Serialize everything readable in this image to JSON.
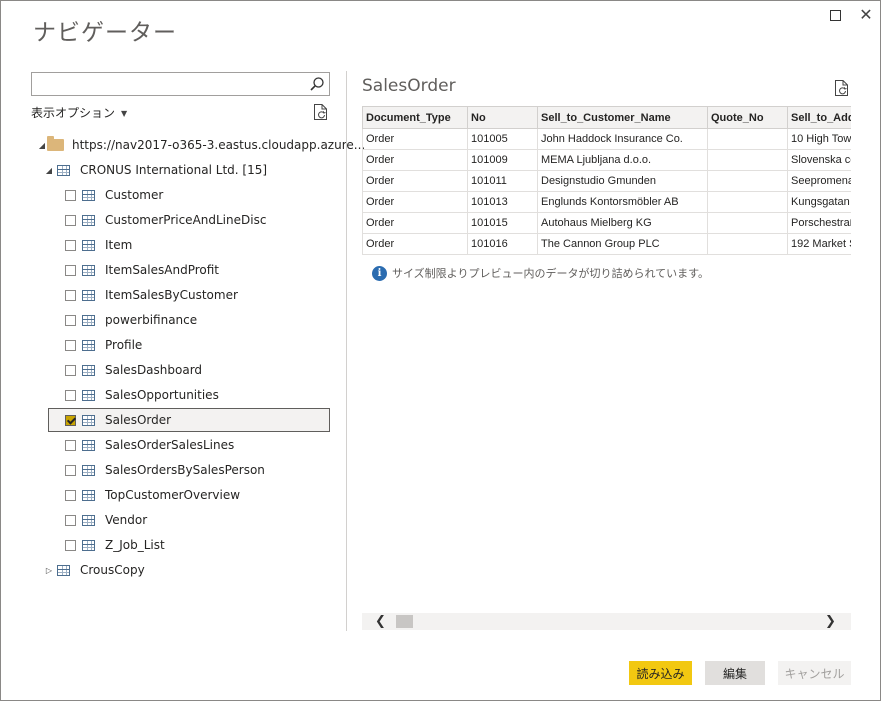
{
  "window": {
    "title": "ナビゲーター"
  },
  "search": {
    "placeholder": ""
  },
  "display_options": {
    "label": "表示オプション"
  },
  "tree": {
    "root": {
      "label": "https://nav2017-o365-3.eastus.cloudapp.azure..."
    },
    "company": {
      "label": "CRONUS International Ltd. [15]"
    },
    "items": [
      {
        "label": "Customer",
        "checked": false
      },
      {
        "label": "CustomerPriceAndLineDisc",
        "checked": false
      },
      {
        "label": "Item",
        "checked": false
      },
      {
        "label": "ItemSalesAndProfit",
        "checked": false
      },
      {
        "label": "ItemSalesByCustomer",
        "checked": false
      },
      {
        "label": "powerbifinance",
        "checked": false
      },
      {
        "label": "Profile",
        "checked": false
      },
      {
        "label": "SalesDashboard",
        "checked": false
      },
      {
        "label": "SalesOpportunities",
        "checked": false
      },
      {
        "label": "SalesOrder",
        "checked": true
      },
      {
        "label": "SalesOrderSalesLines",
        "checked": false
      },
      {
        "label": "SalesOrdersBySalesPerson",
        "checked": false
      },
      {
        "label": "TopCustomerOverview",
        "checked": false
      },
      {
        "label": "Vendor",
        "checked": false
      },
      {
        "label": "Z_Job_List",
        "checked": false
      }
    ],
    "other": {
      "label": "CrousCopy"
    }
  },
  "preview": {
    "title": "SalesOrder",
    "columns": [
      "Document_Type",
      "No",
      "Sell_to_Customer_Name",
      "Quote_No",
      "Sell_to_Add"
    ],
    "rows": [
      [
        "Order",
        "101005",
        "John Haddock Insurance Co.",
        "",
        "10 High Tow"
      ],
      [
        "Order",
        "101009",
        "MEMA Ljubljana d.o.o.",
        "",
        "Slovenska cc"
      ],
      [
        "Order",
        "101011",
        "Designstudio Gmunden",
        "",
        "Seepromena"
      ],
      [
        "Order",
        "101013",
        "Englunds Kontorsmöbler AB",
        "",
        "Kungsgatan"
      ],
      [
        "Order",
        "101015",
        "Autohaus Mielberg KG",
        "",
        "Porschestraß"
      ],
      [
        "Order",
        "101016",
        "The Cannon Group PLC",
        "",
        "192 Market S"
      ]
    ],
    "info_text": "サイズ制限よりプレビュー内のデータが切り詰められています。"
  },
  "buttons": {
    "load": "読み込み",
    "edit": "編集",
    "cancel": "キャンセル"
  },
  "colors": {
    "accent": "#f2c811",
    "info": "#2b6cb0",
    "folder": "#dcb67a"
  }
}
